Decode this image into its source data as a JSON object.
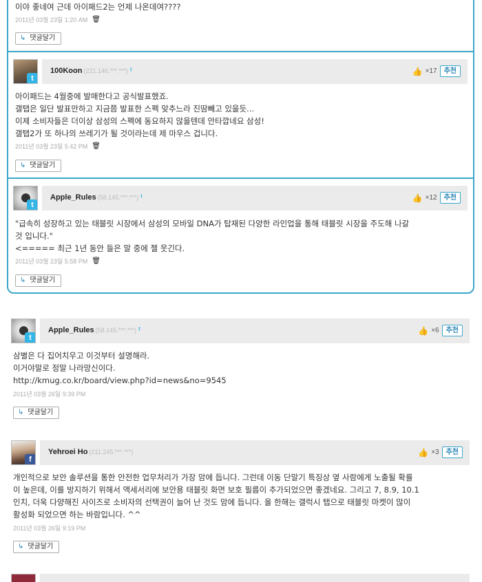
{
  "reply_label": "댓글달기",
  "comments": [
    {
      "text": "이야 좋네여 근데 아이패드2는 언제 나온데여????",
      "date": "2011년 03월 23일 1:20 AM"
    },
    {
      "author": "100Koon",
      "ip": "(221.146.***.***)",
      "rec_count": "×17",
      "rec_label": "추천",
      "text": "아이패드는 4월중에 발매한다고 공식발표했죠.\n갤탭은 일단 발표만하고 지금쯤 발표한 스펙 맞추느라 진땀빼고 있을듯...\n이제 소비자들은 더이상 삼성의 스펙에 동요하지 않을텐데 안타깝네요 삼성!\n갤탭2가 또 하나의 쓰레기가 될 것이라는데 제 마우스 겁니다.",
      "date": "2011년 03월 23일 5:42 PM"
    },
    {
      "author": "Apple_Rules",
      "ip": "(58.145.***.***)",
      "rec_count": "×12",
      "rec_label": "추천",
      "text": "\"급속히 성장하고 있는 태블릿 시장에서 삼성의 모바일 DNA가 탑재된 다양한 라인업을 통해 태블릿 시장을 주도해 나갈\n것 입니다.\"\n<===== 최근 1년 동안 들은 말 중에 젤 웃긴다.",
      "date": "2011년 03월 23일 5:58 PM"
    },
    {
      "author": "Apple_Rules",
      "ip": "(58.145.***.***)",
      "rec_count": "×6",
      "rec_label": "추천",
      "text": "삼별은 다 집어치우고 이것부터 설명해라.\n이거야말로 정말 나라망신이다.\nhttp://kmug.co.kr/board/view.php?id=news&no=9545",
      "date": "2011년 03월 26일 9:39 PM"
    },
    {
      "author": "Yehroei Ho",
      "ip": "(211.245.***.***)",
      "rec_count": "×3",
      "rec_label": "추천",
      "text": "개인적으로 보안 솔루션을 통한 안전한 업무처리가 가장 맘에 듭니다. 그런데 이동 단말기 특징상 옆 사람에게 노출될 확률\n이 높은데, 이를 방지하기 위해서 액세서리에 보안용 태블릿 화면 보호 필름이 추가되었으면 좋겠네요. 그리고 7, 8.9, 10.1\n인치, 더욱 다양해진 사이즈로 소비자의 선택권이 늘어 난 것도 맘에 듭니다. 올 한해는 갤럭시 탭으로 태블릿 마켓이 많이\n활성화 되었으면 하는 바람입니다. ^^",
      "date": "2011년 03월 26일 9:19 PM"
    }
  ],
  "icons": {
    "reply": "reply-arrow-icon",
    "trash": "trash-icon",
    "thumb": "thumbs-up-icon",
    "twitter": "twitter-icon",
    "facebook": "facebook-icon"
  },
  "colors": {
    "accent": "#3aa6c9",
    "header_bg": "#ebebeb"
  }
}
